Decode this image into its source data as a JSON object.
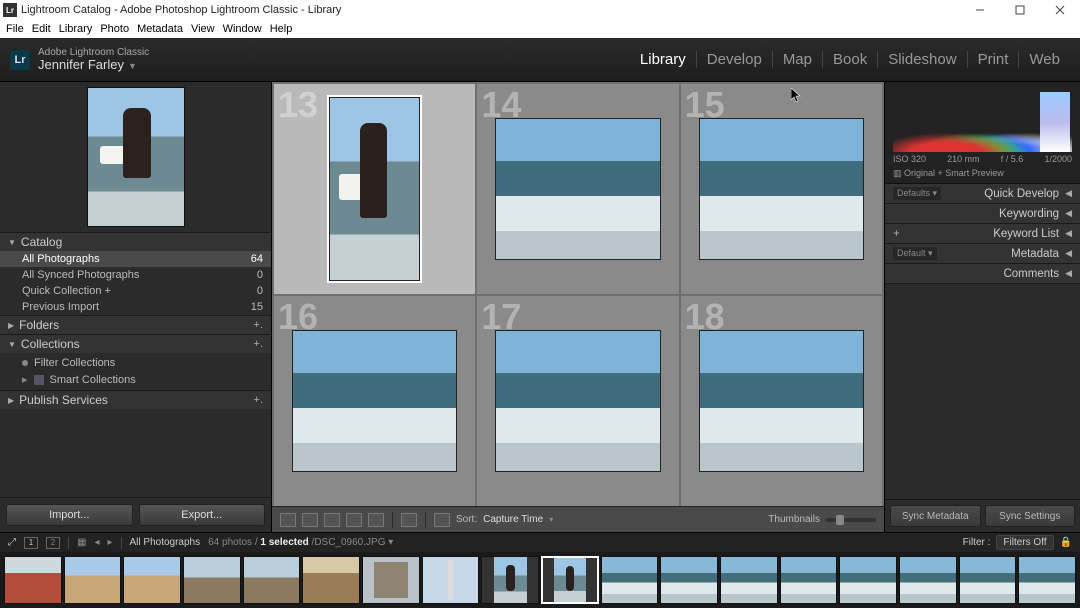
{
  "window": {
    "title": "Lightroom Catalog - Adobe Photoshop Lightroom Classic - Library",
    "logo_text": "Lr"
  },
  "menu": [
    "File",
    "Edit",
    "Library",
    "Photo",
    "Metadata",
    "View",
    "Window",
    "Help"
  ],
  "header": {
    "product": "Adobe Lightroom Classic",
    "user": "Jennifer Farley",
    "modules": [
      "Library",
      "Develop",
      "Map",
      "Book",
      "Slideshow",
      "Print",
      "Web"
    ],
    "active_module": "Library",
    "logo": "Lr"
  },
  "left_panel": {
    "sections": {
      "catalog": {
        "title": "Catalog",
        "items": [
          {
            "label": "All Photographs",
            "count": "64",
            "selected": true
          },
          {
            "label": "All Synced Photographs",
            "count": "0"
          },
          {
            "label": "Quick Collection  +",
            "count": "0"
          },
          {
            "label": "Previous Import",
            "count": "15"
          }
        ]
      },
      "folders": {
        "title": "Folders"
      },
      "collections": {
        "title": "Collections",
        "filter": "Filter Collections",
        "smart": "Smart Collections"
      },
      "publish": {
        "title": "Publish Services"
      }
    },
    "buttons": {
      "import": "Import...",
      "export": "Export..."
    }
  },
  "grid": {
    "cells": [
      {
        "num": "13",
        "selected": true,
        "orient": "vert"
      },
      {
        "num": "14"
      },
      {
        "num": "15"
      },
      {
        "num": "16"
      },
      {
        "num": "17"
      },
      {
        "num": "18"
      }
    ],
    "toolbar": {
      "sort_label": "Sort:",
      "sort_value": "Capture Time",
      "thumbnails": "Thumbnails"
    }
  },
  "right_panel": {
    "histo": {
      "iso": "ISO 320",
      "fl": "210 mm",
      "ap": "f / 5.6",
      "ss": "1/2000",
      "sub": "Original + Smart Preview"
    },
    "sections": [
      {
        "tag": "Defaults",
        "label": "Quick Develop"
      },
      {
        "label": "Keywording"
      },
      {
        "plus": true,
        "label": "Keyword List"
      },
      {
        "tag": "Default",
        "label": "Metadata"
      },
      {
        "label": "Comments"
      }
    ],
    "sync": {
      "meta": "Sync Metadata",
      "settings": "Sync Settings"
    }
  },
  "status": {
    "source": "All Photographs",
    "counts": "64 photos /",
    "selected": "1 selected",
    "file": "/DSC_0960.JPG",
    "filter_label": "Filter :",
    "filter_value": "Filters Off"
  },
  "filmstrip_count": 18
}
